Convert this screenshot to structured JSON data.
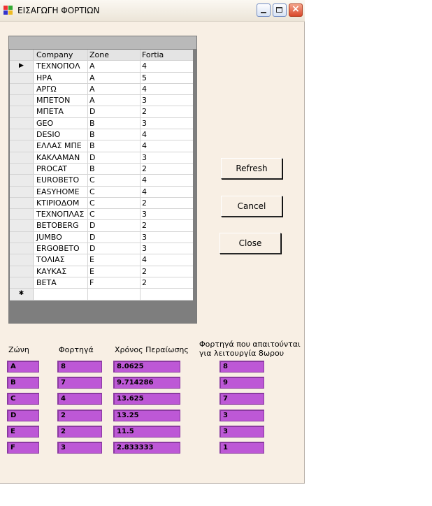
{
  "window": {
    "title": "ΕΙΣΑΓΩΓΗ ΦΟΡΤΙΩΝ"
  },
  "grid": {
    "columns": [
      "Company",
      "Zone",
      "Fortia"
    ],
    "rows": [
      [
        "ΤΕΧΝΟΠΟΛ",
        "A",
        "4"
      ],
      [
        "ΗΡΑ",
        "A",
        "5"
      ],
      [
        "ΑΡΓΩ",
        "A",
        "4"
      ],
      [
        "ΜΠΕΤΟΝ",
        "A",
        "3"
      ],
      [
        "ΜΠΕΤΑ",
        "D",
        "2"
      ],
      [
        "GEO",
        "B",
        "3"
      ],
      [
        "DESIO",
        "B",
        "4"
      ],
      [
        "ΕΛΛΑΣ ΜΠΕ",
        "B",
        "4"
      ],
      [
        "ΚΑΚΛΑΜΑΝ",
        "D",
        "3"
      ],
      [
        "PROCAT",
        "B",
        "2"
      ],
      [
        "EUROBETO",
        "C",
        "4"
      ],
      [
        "EASYHOME",
        "C",
        "4"
      ],
      [
        "ΚΤΙΡΙΟΔΟΜ",
        "C",
        "2"
      ],
      [
        "ΤΕΧΝΟΠΛΑΣ",
        "C",
        "3"
      ],
      [
        "BETOBERG",
        "D",
        "2"
      ],
      [
        "JUMBO",
        "D",
        "3"
      ],
      [
        "ERGOBETO",
        "D",
        "3"
      ],
      [
        "ΤΟΛΙΑΣ",
        "E",
        "4"
      ],
      [
        "ΚΑΥΚΑΣ",
        "E",
        "2"
      ],
      [
        "ΒΕΤΑ",
        "F",
        "2"
      ]
    ],
    "current_row_marker": "▶",
    "new_row_marker": "✱"
  },
  "buttons": {
    "refresh": "Refresh",
    "cancel": "Cancel",
    "close": "Close"
  },
  "summary": {
    "headers": {
      "zone": "Ζώνη",
      "loads": "Φορτηγά",
      "wait_time": "Χρόνος Περαίωσης",
      "required_line1": "Φορτηγά που απαιτούνται",
      "required_line2": "για λειτουργία 8ωρου"
    },
    "rows": [
      {
        "zone": "A",
        "loads": "8",
        "wait_time": "8.0625",
        "required": "8"
      },
      {
        "zone": "B",
        "loads": "7",
        "wait_time": "9.714286",
        "required": "9"
      },
      {
        "zone": "C",
        "loads": "4",
        "wait_time": "13.625",
        "required": "7"
      },
      {
        "zone": "D",
        "loads": "2",
        "wait_time": "13.25",
        "required": "3"
      },
      {
        "zone": "E",
        "loads": "2",
        "wait_time": "11.5",
        "required": "3"
      },
      {
        "zone": "F",
        "loads": "3",
        "wait_time": "2.833333",
        "required": "1"
      }
    ]
  },
  "colors": {
    "field_fill": "#bd58d6",
    "window_bg": "#f8efe4"
  }
}
